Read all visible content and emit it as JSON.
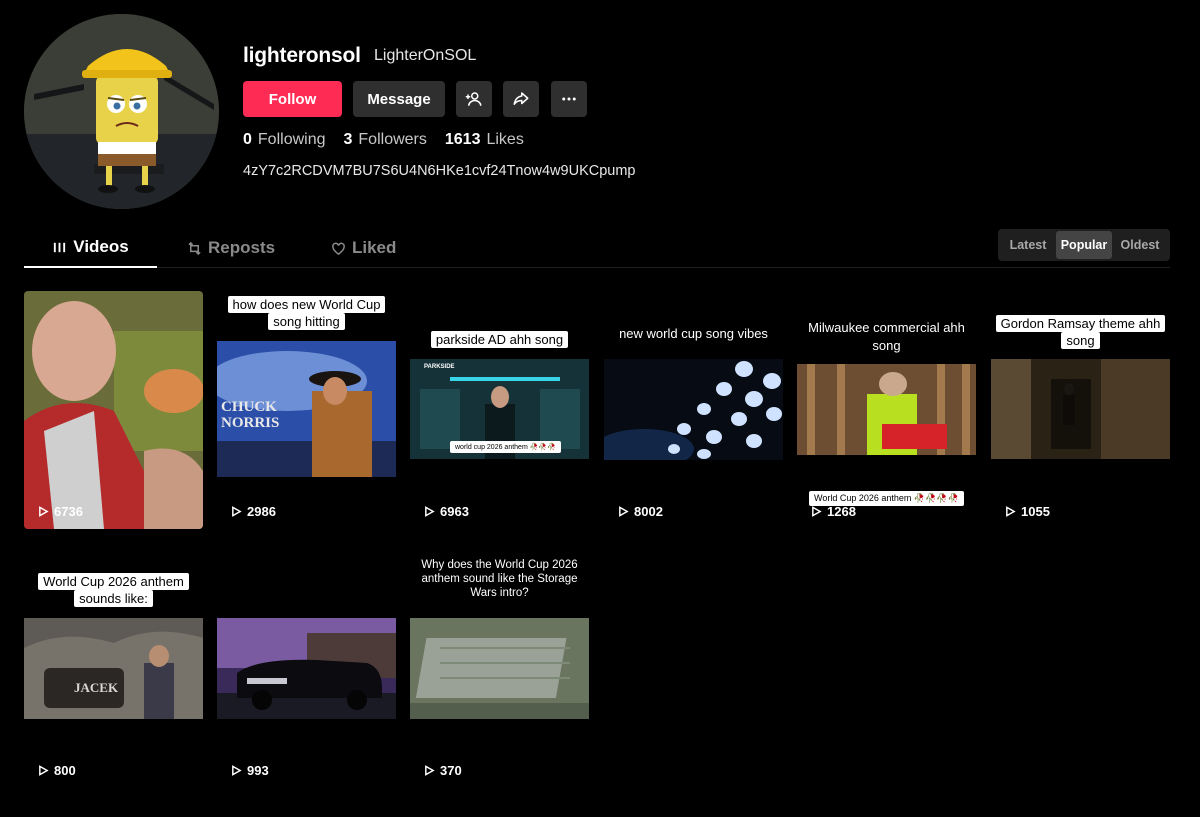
{
  "profile": {
    "username": "lighteronsol",
    "display_name": "LighterOnSOL",
    "bio": "4zY7c2RCDVM7BU7S6U4N6HKe1cvf24Tnow4w9UKCpump",
    "follow_label": "Follow",
    "message_label": "Message",
    "stats": {
      "following_count": "0",
      "following_label": "Following",
      "followers_count": "3",
      "followers_label": "Followers",
      "likes_count": "1613",
      "likes_label": "Likes"
    }
  },
  "tabs": [
    {
      "label": "Videos",
      "icon": "grid-bars-icon"
    },
    {
      "label": "Reposts",
      "icon": "repost-icon"
    },
    {
      "label": "Liked",
      "icon": "heart-outline-icon"
    }
  ],
  "sort": {
    "options": [
      "Latest",
      "Popular",
      "Oldest"
    ],
    "selected": "Popular"
  },
  "videos": [
    {
      "views": "6736",
      "caption": ""
    },
    {
      "views": "2986",
      "caption": "how does new World Cup song hitting"
    },
    {
      "views": "6963",
      "caption": "parkside AD ahh song",
      "sticker": "world cup 2026 anthem 🥀🥀🥀",
      "scene_label": "PARKSIDE"
    },
    {
      "views": "8002",
      "caption": "new world cup song vibes"
    },
    {
      "views": "1268",
      "caption": "Milwaukee commercial ahh song",
      "sticker": "World Cup 2026 anthem 🥀🥀🥀🥀"
    },
    {
      "views": "1055",
      "caption": "Gordon Ramsay  theme ahh song"
    },
    {
      "views": "800",
      "caption": "World Cup 2026 anthem sounds like:",
      "scene_label": "JACEK"
    },
    {
      "views": "993",
      "caption": ""
    },
    {
      "views": "370",
      "caption": "Why does the World Cup 2026 anthem sound like the Storage Wars intro?"
    }
  ],
  "scene_text": {
    "chuck": "CHUCK NORRIS"
  },
  "colors": {
    "follow": "#fe2c55",
    "background": "#000000",
    "button": "#2f2f2f"
  }
}
